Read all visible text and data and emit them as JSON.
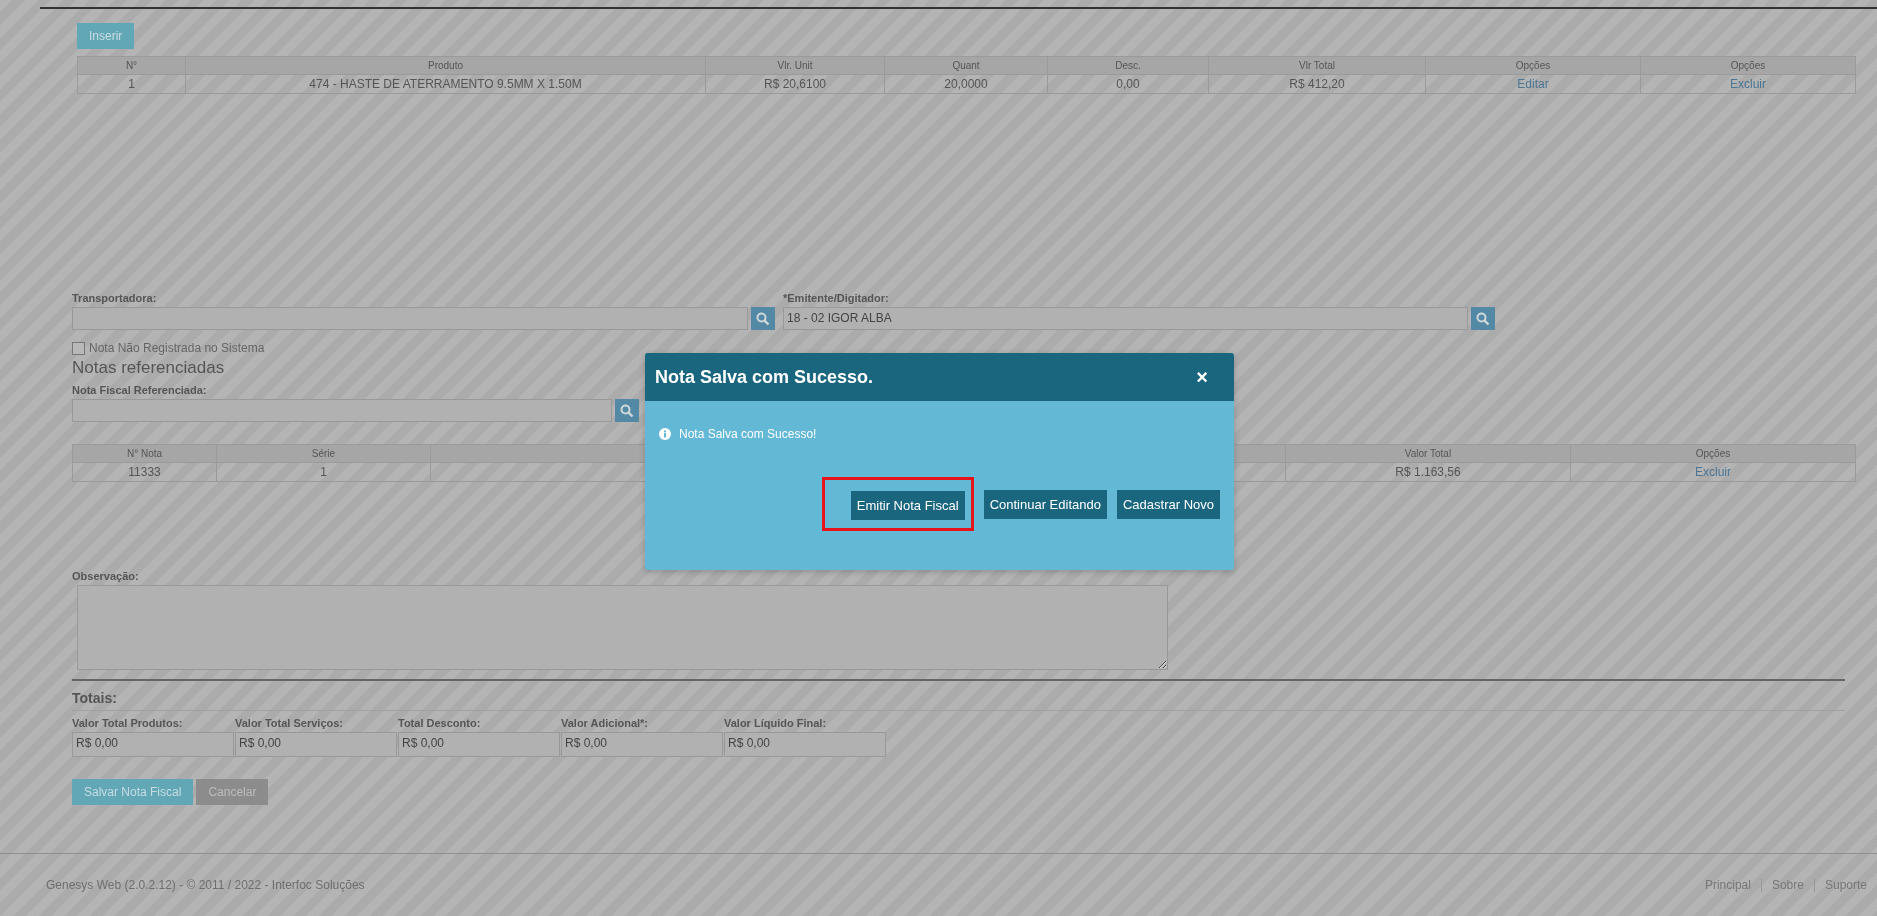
{
  "insert_button": "Inserir",
  "products_table": {
    "columns": [
      "N°",
      "Produto",
      "Vlr. Unit",
      "Quant",
      "Desc.",
      "Vlr Total",
      "Opções",
      "Opções"
    ],
    "rows": [
      {
        "cells": [
          {
            "text": "1",
            "kind": "text"
          },
          {
            "text": "474 - HASTE DE ATERRAMENTO 9.5MM X 1.50M",
            "kind": "text"
          },
          {
            "text": "R$ 20,6100",
            "kind": "text"
          },
          {
            "text": "20,0000",
            "kind": "text"
          },
          {
            "text": "0,00",
            "kind": "text"
          },
          {
            "text": "R$ 412,20",
            "kind": "text"
          },
          {
            "text": "Editar",
            "kind": "link"
          },
          {
            "text": "Excluir",
            "kind": "link"
          }
        ]
      }
    ]
  },
  "lookup_fields": [
    {
      "label": "Transportadora:"
    },
    {
      "label": "*Emitente/Digitador:",
      "value": "18 - 02 IGOR ALBA"
    }
  ],
  "unregistered_checkbox": {
    "label": "Nota Não Registrada no Sistema",
    "checked": false
  },
  "referenced_section": {
    "title": "Notas referenciadas",
    "field_label": "Nota Fiscal Referenciada:",
    "table": {
      "columns": [
        "N° Nota",
        "Série",
        "Valor Total",
        "Opções"
      ],
      "rows": [
        {
          "cells": [
            {
              "text": "11333",
              "kind": "text"
            },
            {
              "text": "1",
              "kind": "text"
            },
            {
              "text": "R$ 1.163,56",
              "kind": "text"
            },
            {
              "text": "Excluir",
              "kind": "link"
            }
          ]
        }
      ]
    }
  },
  "observation_label": "Observação:",
  "totals": {
    "title": "Totais:",
    "fields": [
      {
        "label": "Valor Total Produtos:",
        "value": "R$ 0,00"
      },
      {
        "label": "Valor Total Serviços:",
        "value": "R$ 0,00"
      },
      {
        "label": "Total Desconto:",
        "value": "R$ 0,00"
      },
      {
        "label": "Valor Adicional*:",
        "value": "R$ 0,00"
      },
      {
        "label": "Valor Líquido Final:",
        "value": "R$ 0,00"
      }
    ]
  },
  "form_buttons": [
    {
      "label": "Salvar Nota Fiscal",
      "kind": "primary"
    },
    {
      "label": "Cancelar",
      "kind": "secondary"
    }
  ],
  "footer": {
    "text": "Genesys Web (2.0.2.12) - © 2011 / 2022 - Interfoc Soluções",
    "links": [
      "Principal",
      "Sobre",
      "Suporte"
    ]
  },
  "modal": {
    "title": "Nota Salva com Sucesso.",
    "close": "×",
    "message": "Nota Salva com Sucesso!",
    "buttons": [
      {
        "label": "Emitir Nota Fiscal",
        "highlighted": true
      },
      {
        "label": "Continuar Editando",
        "highlighted": false
      },
      {
        "label": "Cadastrar Novo",
        "highlighted": false
      }
    ]
  }
}
